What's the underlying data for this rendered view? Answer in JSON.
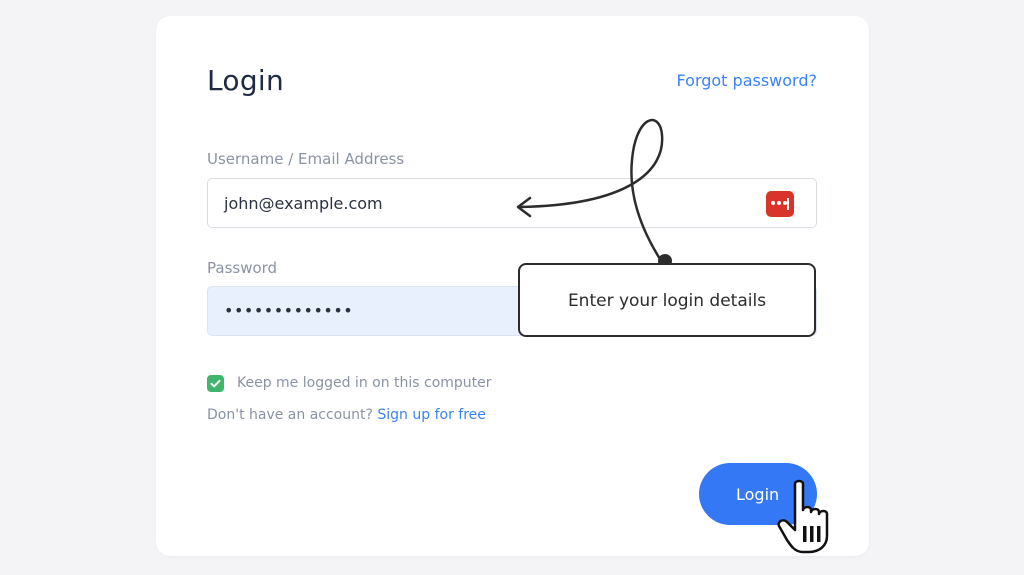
{
  "form": {
    "title": "Login",
    "forgot_password": "Forgot password?",
    "username_label": "Username / Email Address",
    "username_value": "john@example.com",
    "password_label": "Password",
    "password_value": "•••••••••••••",
    "remember_label": "Keep me logged in on this computer",
    "remember_checked": true,
    "no_account_text": "Don't have an account?",
    "signup_link": "Sign up for free",
    "login_button": "Login"
  },
  "annotation": {
    "callout_text": "Enter your login details"
  },
  "colors": {
    "accent": "#3478f6",
    "link": "#3b82f6",
    "check": "#3fb66b",
    "password_manager": "#d9342b"
  },
  "icons": {
    "password_manager": "password-manager-icon",
    "checkbox": "check-icon",
    "cursor": "hand-pointer-icon"
  }
}
